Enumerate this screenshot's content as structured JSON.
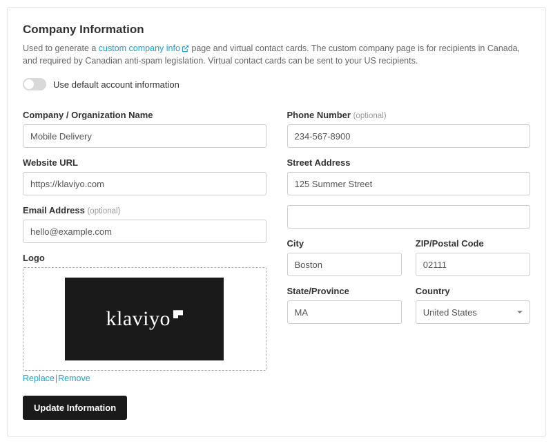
{
  "header": {
    "title": "Company Information",
    "desc_prefix": "Used to generate a ",
    "desc_link": "custom company info",
    "desc_suffix": " page and virtual contact cards. The custom company page is for recipients in Canada, and required by Canadian anti-spam legislation. Virtual contact cards can be sent to your US recipients."
  },
  "toggle": {
    "label": "Use default account information"
  },
  "labels": {
    "company": "Company / Organization Name",
    "website": "Website URL",
    "email": "Email Address",
    "optional": "(optional)",
    "logo": "Logo",
    "phone": "Phone Number",
    "street": "Street Address",
    "city": "City",
    "zip": "ZIP/Postal Code",
    "state": "State/Province",
    "country": "Country"
  },
  "values": {
    "company": "Mobile Delivery",
    "website": "https://klaviyo.com",
    "email": "hello@example.com",
    "phone": "234-567-8900",
    "street": "125 Summer Street",
    "street2": "",
    "city": "Boston",
    "zip": "02111",
    "state": "MA",
    "country": "United States"
  },
  "logo": {
    "brand_text": "klaviyo",
    "replace": "Replace",
    "remove": "Remove"
  },
  "button": {
    "submit": "Update Information"
  }
}
